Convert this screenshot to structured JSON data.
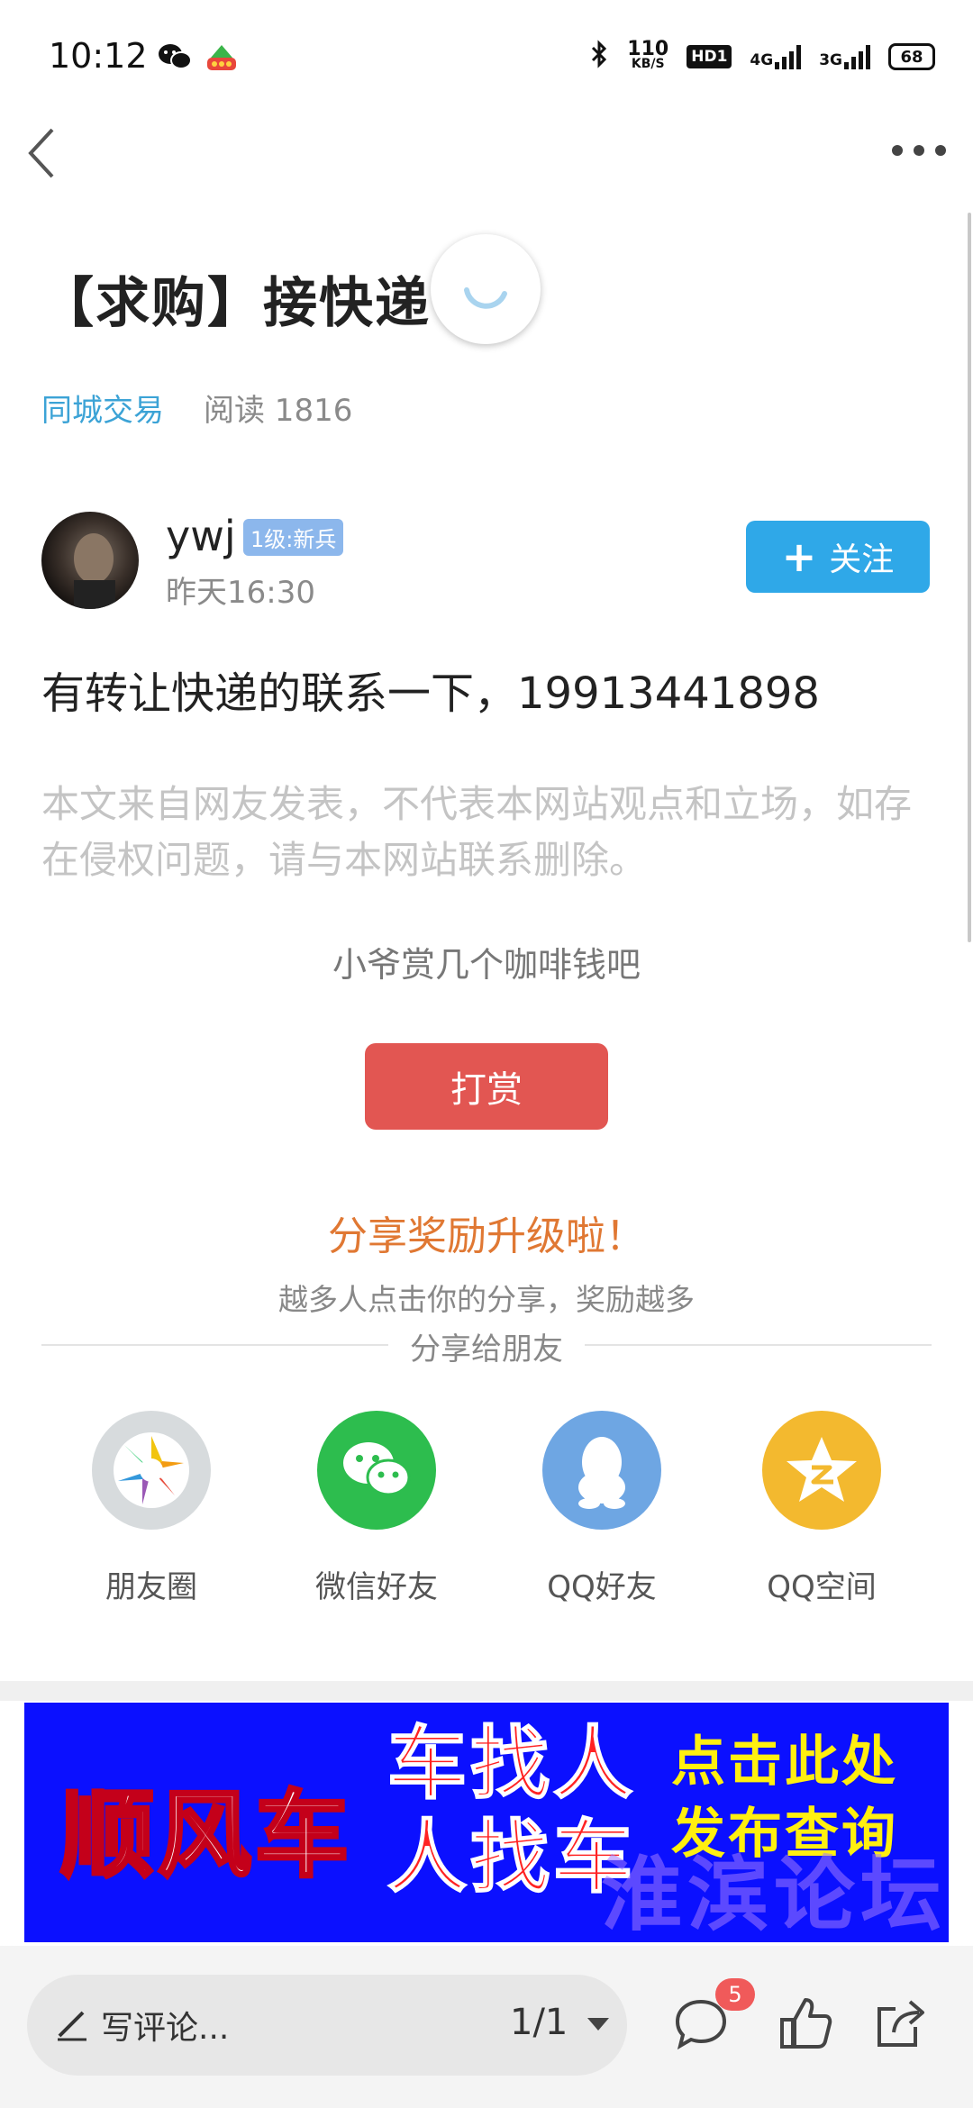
{
  "status_bar": {
    "time": "10:12",
    "net_speed_value": "110",
    "net_speed_unit": "KB/S",
    "hd_label": "HD1",
    "signal_1": "4G",
    "signal_2": "3G",
    "battery": "68"
  },
  "nav": {
    "back_icon": "chevron-left-icon",
    "more_icon": "more-horizontal-icon"
  },
  "post": {
    "title": "【求购】接快递",
    "category": "同城交易",
    "read_label": "阅读 1816",
    "author": {
      "name": "ywj",
      "level_badge": "1级:新兵",
      "time": "昨天16:30"
    },
    "follow_label": "关注",
    "content": "有转让快递的联系一下，19913441898",
    "disclaimer": "本文来自网友发表，不代表本网站观点和立场，如存在侵权问题，请与本网站联系删除。"
  },
  "tip": {
    "text": "小爷赏几个咖啡钱吧",
    "button_label": "打赏"
  },
  "share": {
    "title": "分享奖励升级啦！",
    "subtitle": "越多人点击你的分享，奖励越多",
    "divider_label": "分享给朋友",
    "items": [
      {
        "label": "朋友圈",
        "icon": "moments-icon",
        "color": "#d7dbdd"
      },
      {
        "label": "微信好友",
        "icon": "wechat-icon",
        "color": "#2dbd4e"
      },
      {
        "label": "QQ好友",
        "icon": "qq-icon",
        "color": "#6ea6e3"
      },
      {
        "label": "QQ空间",
        "icon": "qzone-icon",
        "color": "#f3b92f"
      }
    ]
  },
  "banner": {
    "text_main": "顺风车",
    "text_line1": "车找人",
    "text_line2": "人找车",
    "cta_line1": "点击此处",
    "cta_line2": "发布查询",
    "watermark": "淮滨论坛"
  },
  "bottom_bar": {
    "comment_placeholder": "写评论...",
    "page_indicator": "1/1",
    "comment_count": "5"
  },
  "colors": {
    "accent_blue": "#2fa8e8",
    "tip_red": "#e25652",
    "share_orange": "#e07833",
    "category_blue": "#3ca3d6"
  }
}
